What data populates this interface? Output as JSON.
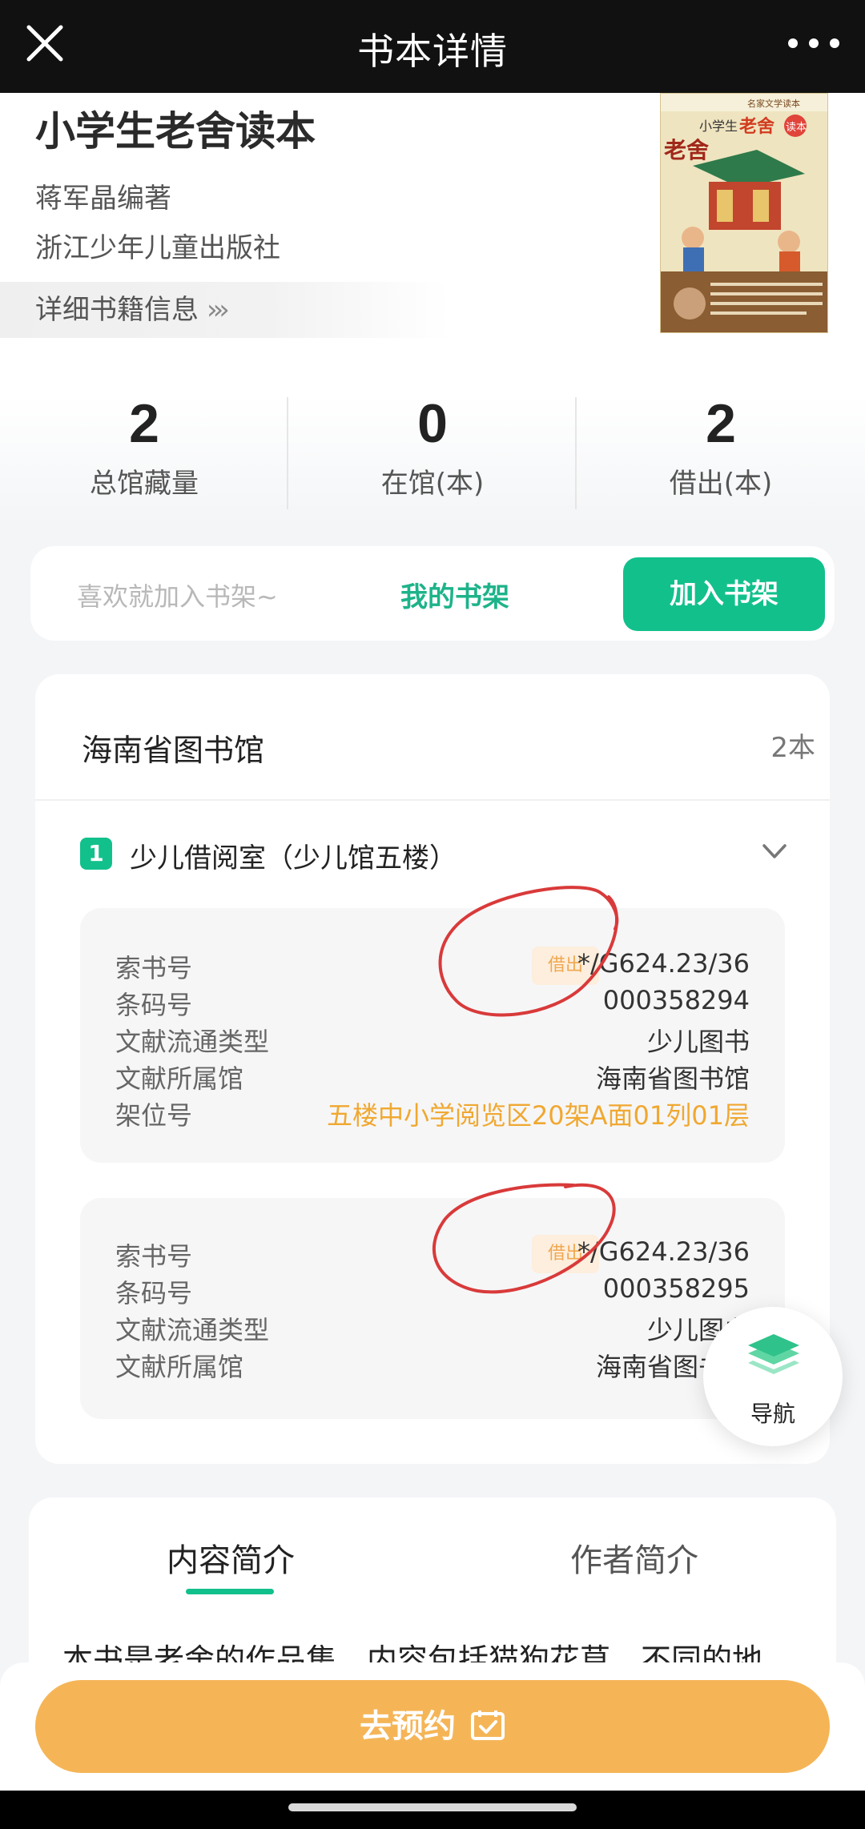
{
  "topbar": {
    "title": "书本详情",
    "close_icon": "close-icon",
    "more_icon": "more-dots-icon"
  },
  "book": {
    "title": "小学生老舍读本",
    "author": "蒋军晶编著",
    "publisher": "浙江少年儿童出版社",
    "detail_link": "详细书籍信息",
    "cover": {
      "series": "名家文学读本",
      "title_prefix": "小学生",
      "title_name": "老舍",
      "title_suffix": "读本",
      "side_name": "老舍"
    }
  },
  "stats": [
    {
      "num": "2",
      "label": "总馆藏量"
    },
    {
      "num": "0",
      "label": "在馆(本)"
    },
    {
      "num": "2",
      "label": "借出(本)"
    }
  ],
  "shelf": {
    "hint": "喜欢就加入书架~",
    "my_shelf": "我的书架",
    "add": "加入书架"
  },
  "holdings": {
    "library": "海南省图书馆",
    "count": "2本",
    "room_index": "1",
    "room_name": "少儿借阅室（少儿馆五楼）",
    "copies": [
      {
        "status": "借出",
        "rows": [
          {
            "k": "索书号",
            "v": "*/G624.23/36"
          },
          {
            "k": "条码号",
            "v": "000358294"
          },
          {
            "k": "文献流通类型",
            "v": "少儿图书"
          },
          {
            "k": "文献所属馆",
            "v": "海南省图书馆"
          },
          {
            "k": "架位号",
            "v": "五楼中小学阅览区20架A面01列01层"
          }
        ]
      },
      {
        "status": "借出",
        "rows": [
          {
            "k": "索书号",
            "v": "*/G624.23/36"
          },
          {
            "k": "条码号",
            "v": "000358295"
          },
          {
            "k": "文献流通类型",
            "v": "少儿图书"
          },
          {
            "k": "文献所属馆",
            "v": "海南省图书馆"
          }
        ]
      }
    ]
  },
  "nav": {
    "label": "导航",
    "icon": "layers-icon"
  },
  "intro": {
    "tabs": [
      "内容简介",
      "作者简介"
    ],
    "text": "本书是老舍的作品集，内容包括猫狗花草，不同的地"
  },
  "reserve": {
    "label": "去预约",
    "icon": "calendar-check-icon"
  },
  "colors": {
    "accent": "#12c08c",
    "reserve": "#f5b557",
    "status_tag": "#f0a850",
    "shelf_location": "#f0a830"
  }
}
